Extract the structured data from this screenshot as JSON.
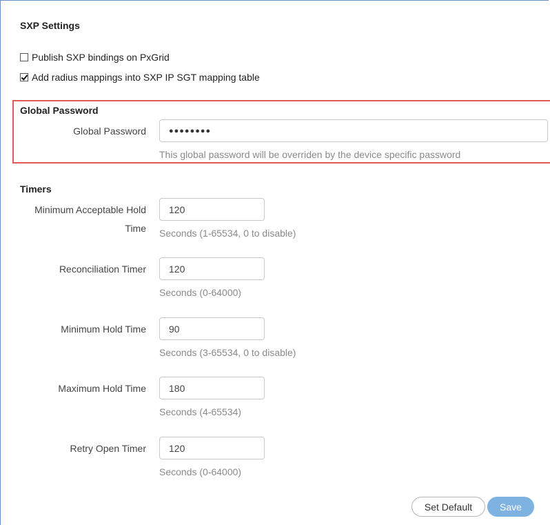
{
  "sxp_settings": {
    "title": "SXP Settings",
    "publish_bindings": {
      "label": "Publish SXP bindings on PxGrid",
      "checked": false
    },
    "add_radius_mappings": {
      "label": "Add radius mappings into SXP IP SGT mapping table",
      "checked": true
    }
  },
  "global_password": {
    "section_title": "Global Password",
    "label": "Global Password",
    "value_masked": "●●●●●●●●",
    "hint": "This global password will be overriden by the device specific password"
  },
  "timers": {
    "title": "Timers",
    "min_acceptable_hold": {
      "label_line1": "Minimum Acceptable Hold",
      "label_line2": "Time",
      "value": "120",
      "hint": "Seconds (1-65534, 0 to disable)"
    },
    "reconciliation": {
      "label": "Reconciliation Timer",
      "value": "120",
      "hint": "Seconds (0-64000)"
    },
    "min_hold": {
      "label": "Minimum Hold Time",
      "value": "90",
      "hint": "Seconds (3-65534, 0 to disable)"
    },
    "max_hold": {
      "label": "Maximum Hold Time",
      "value": "180",
      "hint": "Seconds (4-65534)"
    },
    "retry_open": {
      "label": "Retry Open Timer",
      "value": "120",
      "hint": "Seconds (0-64000)"
    }
  },
  "actions": {
    "set_default_label": "Set Default",
    "save_label": "Save"
  }
}
